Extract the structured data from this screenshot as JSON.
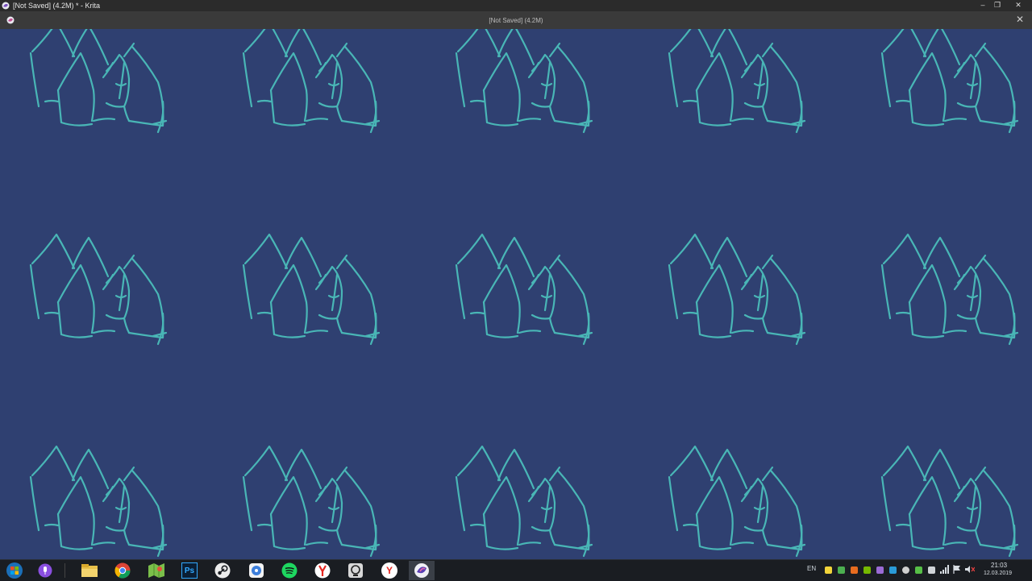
{
  "window": {
    "title": "[Not Saved]  (4.2M) * - Krita",
    "min_glyph": "–",
    "restore_glyph": "❐",
    "close_glyph": "✕"
  },
  "tab": {
    "title": "[Not Saved]  (4.2M)",
    "close_glyph": "✕"
  },
  "canvas": {
    "background": "#2f4071",
    "stroke_color": "#49b6b6",
    "pattern_columns": 5,
    "pattern_rows": 3
  },
  "taskbar": {
    "apps": [
      {
        "name": "start-button-icon"
      },
      {
        "name": "cortana-icon"
      },
      {
        "name": "file-explorer-icon"
      },
      {
        "name": "chrome-icon"
      },
      {
        "name": "maps-icon"
      },
      {
        "name": "photoshop-icon",
        "label": "Ps"
      },
      {
        "name": "steam-icon"
      },
      {
        "name": "disk-icon"
      },
      {
        "name": "spotify-icon"
      },
      {
        "name": "yandex-browser-icon"
      },
      {
        "name": "obs-icon"
      },
      {
        "name": "yandex-icon",
        "label": "Y"
      },
      {
        "name": "krita-icon"
      }
    ],
    "tray": {
      "language": "EN",
      "time": "21:03",
      "date": "12.03.2019"
    }
  }
}
